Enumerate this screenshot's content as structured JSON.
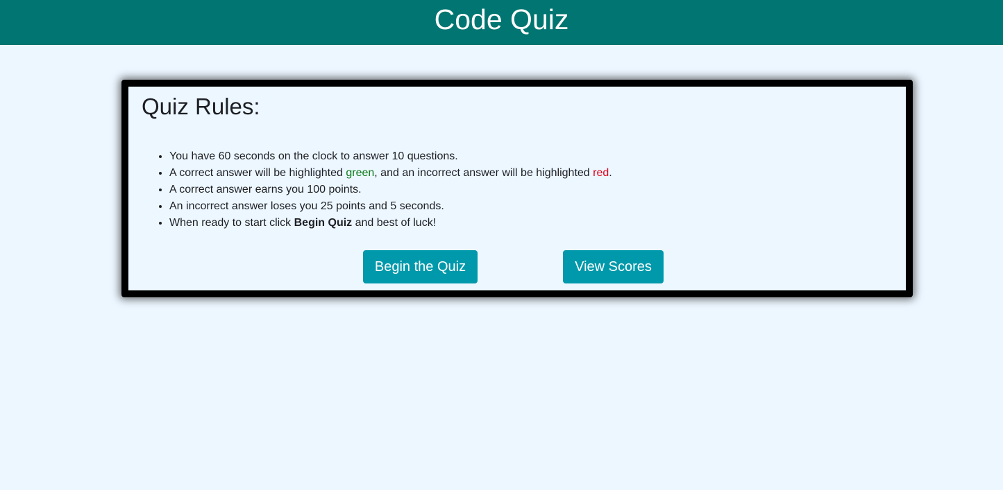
{
  "header": {
    "title": "Code Quiz"
  },
  "rules": {
    "title": "Quiz Rules:",
    "items": {
      "r1": "You have 60 seconds on the clock to answer 10 questions.",
      "r2a": "A correct answer will be highlighted ",
      "r2_green": "green",
      "r2b": ", and an incorrect answer will be highlighted ",
      "r2_red": "red",
      "r2c": ".",
      "r3": "A correct answer earns you 100 points.",
      "r4": "An incorrect answer loses you 25 points and 5 seconds.",
      "r5a": "When ready to start click ",
      "r5_bold": "Begin Quiz",
      "r5b": " and best of luck!"
    }
  },
  "buttons": {
    "begin_label": "Begin the Quiz",
    "scores_label": "View Scores"
  },
  "colors": {
    "header_bg": "#007571",
    "page_bg": "#edf7ff",
    "button_bg": "#0099ab",
    "correct": "#0a7a17",
    "incorrect": "#e0001b"
  }
}
